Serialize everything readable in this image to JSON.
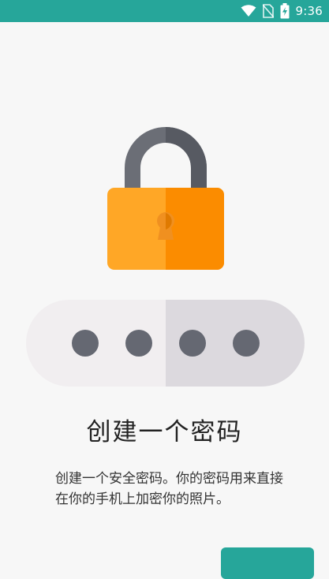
{
  "status_bar": {
    "time": "9:36",
    "icons": [
      "wifi-icon",
      "no-sim-icon",
      "battery-charging-icon"
    ],
    "background_color": "#26a69a"
  },
  "illustration": {
    "icons": [
      "padlock-icon",
      "password-dots-icon"
    ],
    "lock_body_color": "#ffa726",
    "lock_shackle_color": "#6b6e76",
    "dots_color": "#656872",
    "masked_dot_count": 4
  },
  "content": {
    "title": "创建一个密码",
    "description": "创建一个安全密码。你的密码用来直接在你的手机上加密你的照片。"
  },
  "accent_color": "#26a69a"
}
